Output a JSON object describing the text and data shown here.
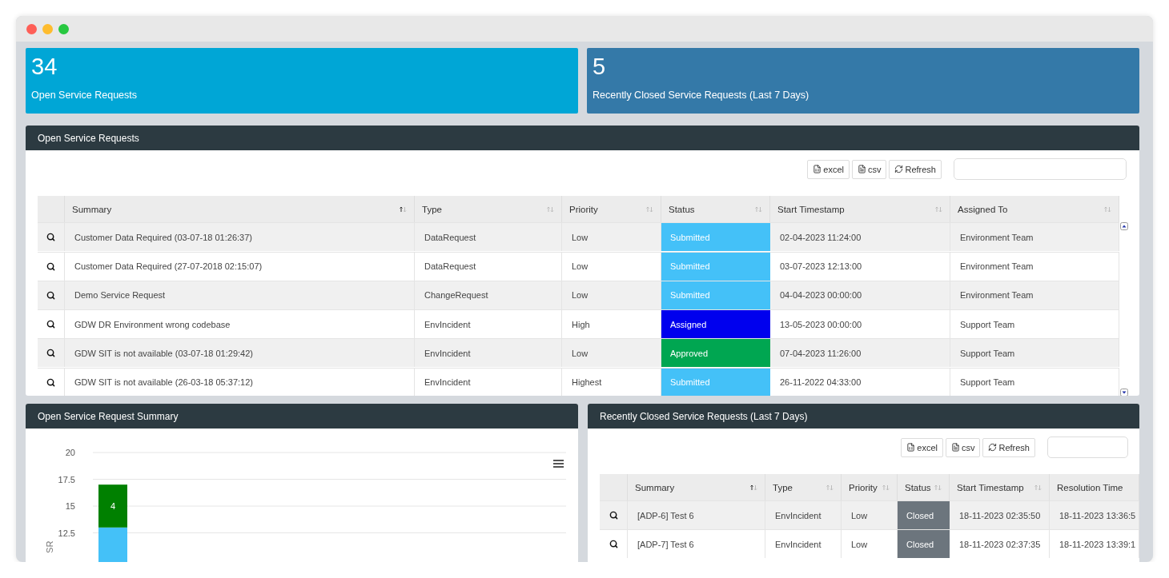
{
  "stats": [
    {
      "value": "34",
      "label": "Open Service Requests",
      "color": "#00a6d6"
    },
    {
      "value": "5",
      "label": "Recently Closed Service Requests (Last 7 Days)",
      "color": "#3479a8"
    }
  ],
  "open_requests": {
    "title": "Open Service Requests",
    "buttons": [
      {
        "kind": "excel",
        "label": "excel"
      },
      {
        "kind": "csv",
        "label": "csv"
      },
      {
        "kind": "refresh",
        "label": "Refresh"
      }
    ],
    "columns": [
      {
        "label": "Summary",
        "sorted": true
      },
      {
        "label": "Type",
        "sorted": false
      },
      {
        "label": "Priority",
        "sorted": false
      },
      {
        "label": "Status",
        "sorted": false
      },
      {
        "label": "Start Timestamp",
        "sorted": false
      },
      {
        "label": "Assigned To",
        "sorted": false
      }
    ],
    "rows": [
      {
        "summary": "Customer Data Required (03-07-18 01:26:37)",
        "type": "DataRequest",
        "priority": "Low",
        "status": "Submitted",
        "color": "#44c1f8",
        "start": "02-04-2023 11:24:00",
        "assigned": "Environment Team"
      },
      {
        "summary": "Customer Data Required (27-07-2018 02:15:07)",
        "type": "DataRequest",
        "priority": "Low",
        "status": "Submitted",
        "color": "#44c1f8",
        "start": "03-07-2023 12:13:00",
        "assigned": "Environment Team"
      },
      {
        "summary": "Demo Service Request",
        "type": "ChangeRequest",
        "priority": "Low",
        "status": "Submitted",
        "color": "#44c1f8",
        "start": "04-04-2023 00:00:00",
        "assigned": "Environment Team"
      },
      {
        "summary": "GDW DR Environment wrong codebase",
        "type": "EnvIncident",
        "priority": "High",
        "status": "Assigned",
        "color": "#0000ee",
        "start": "13-05-2023 00:00:00",
        "assigned": "Support Team"
      },
      {
        "summary": "GDW SIT is not available (03-07-18 01:29:42)",
        "type": "EnvIncident",
        "priority": "Low",
        "status": "Approved",
        "color": "#00a651",
        "start": "07-04-2023 11:26:00",
        "assigned": "Support Team"
      },
      {
        "summary": "GDW SIT is not available (26-03-18 05:37:12)",
        "type": "EnvIncident",
        "priority": "Highest",
        "status": "Submitted",
        "color": "#44c1f8",
        "start": "26-11-2022 04:33:00",
        "assigned": "Support Team"
      }
    ]
  },
  "summary_chart": {
    "title": "Open Service Request Summary",
    "chart_data": {
      "type": "bar",
      "stacked": true,
      "ylabel": "SR",
      "ylim": [
        0,
        20
      ],
      "yticks": [
        12.5,
        15,
        17.5,
        20
      ],
      "series": [
        {
          "color": "#44c1f8",
          "values": [
            13
          ],
          "value_labels": [
            null
          ]
        },
        {
          "color": "#008000",
          "values": [
            4
          ],
          "value_labels": [
            "4"
          ]
        }
      ],
      "grid": true
    }
  },
  "closed_requests": {
    "title": "Recently Closed Service Requests (Last 7 Days)",
    "buttons": [
      {
        "kind": "excel",
        "label": "excel"
      },
      {
        "kind": "csv",
        "label": "csv"
      },
      {
        "kind": "refresh",
        "label": "Refresh"
      }
    ],
    "columns": [
      {
        "label": "Summary",
        "sorted": true
      },
      {
        "label": "Type",
        "sorted": false
      },
      {
        "label": "Priority",
        "sorted": false
      },
      {
        "label": "Status",
        "sorted": false
      },
      {
        "label": "Start Timestamp",
        "sorted": false
      },
      {
        "label": "Resolution Time"
      }
    ],
    "rows": [
      {
        "summary": "[ADP-6] Test 6",
        "type": "EnvIncident",
        "priority": "Low",
        "status": "Closed",
        "color": "#6c757d",
        "start": "18-11-2023 02:35:50",
        "resolution": "18-11-2023 13:36:5"
      },
      {
        "summary": "[ADP-7] Test 6",
        "type": "EnvIncident",
        "priority": "Low",
        "status": "Closed",
        "color": "#6c757d",
        "start": "18-11-2023 02:37:35",
        "resolution": "18-11-2023 13:39:1"
      }
    ]
  }
}
